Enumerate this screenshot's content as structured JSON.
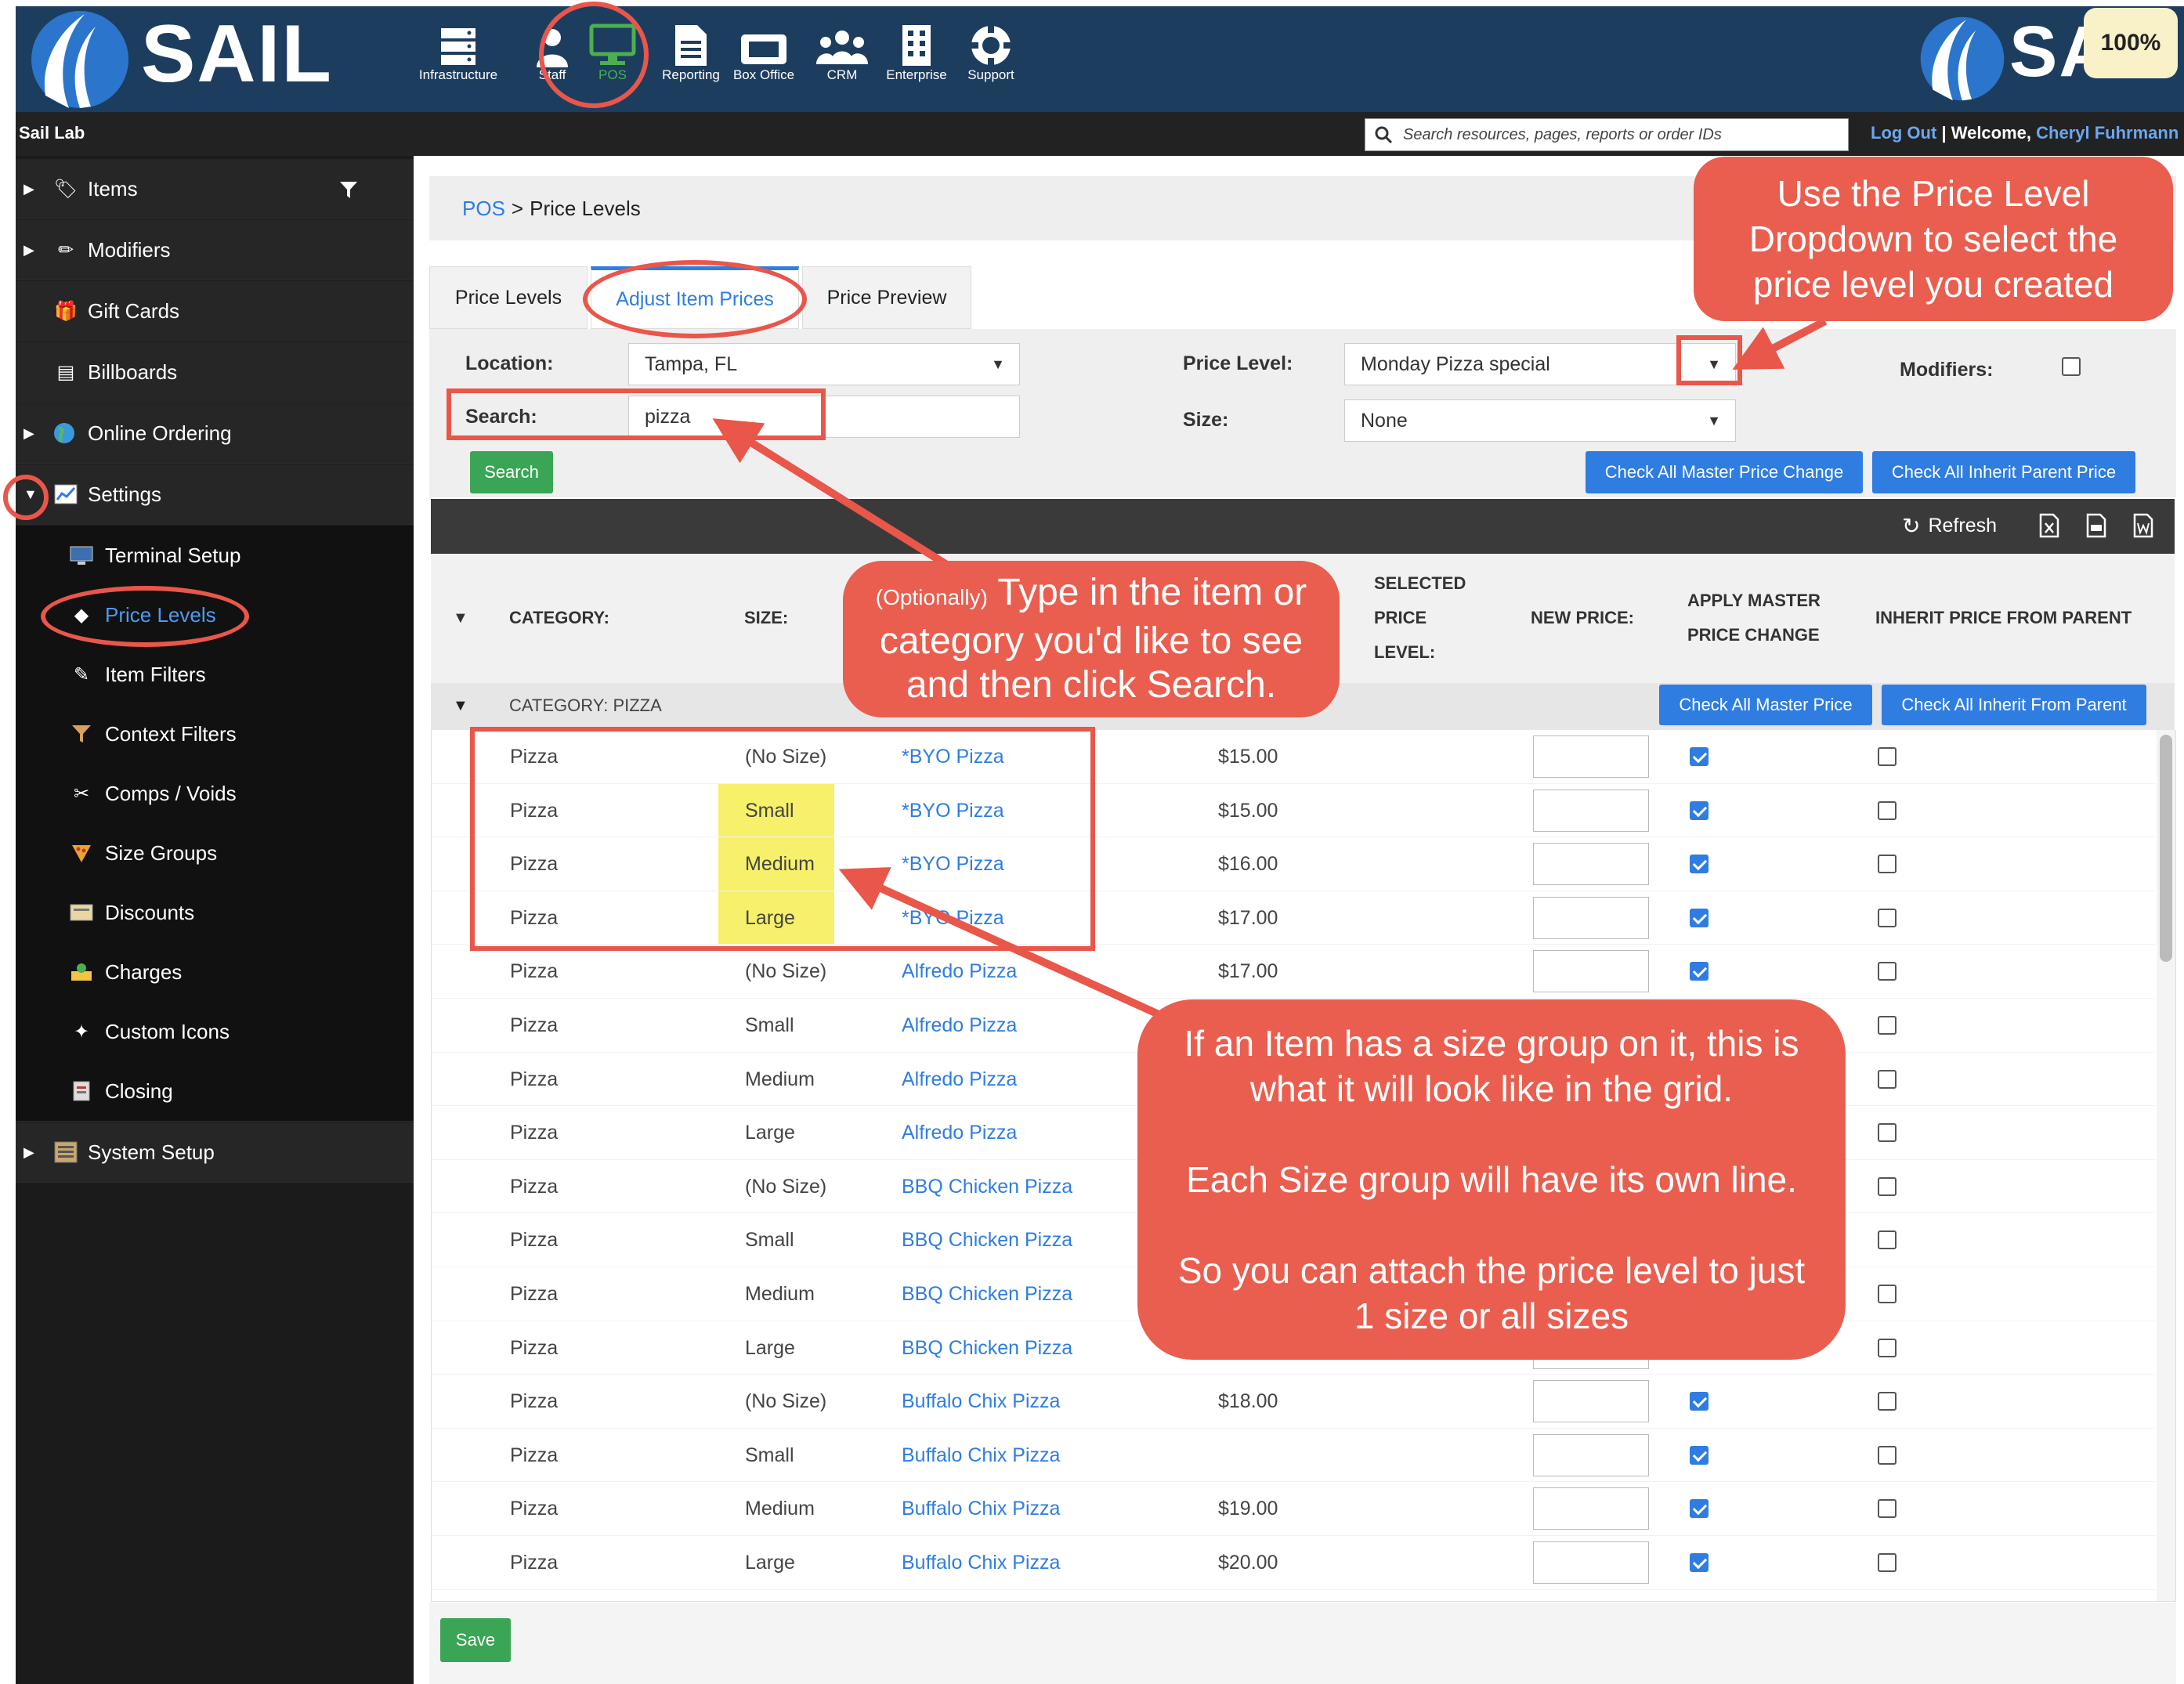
{
  "app": {
    "logo": "SAIL",
    "zoom": "100%"
  },
  "topnav": [
    {
      "label": "Infrastructure",
      "icon": "server-icon"
    },
    {
      "label": "Staff",
      "icon": "staff-icon"
    },
    {
      "label": "POS",
      "icon": "monitor-icon"
    },
    {
      "label": "Reporting",
      "icon": "report-icon"
    },
    {
      "label": "Box Office",
      "icon": "ticket-icon"
    },
    {
      "label": "CRM",
      "icon": "people-icon"
    },
    {
      "label": "Enterprise",
      "icon": "building-icon"
    },
    {
      "label": "Support",
      "icon": "lifebuoy-icon"
    }
  ],
  "header": {
    "site": "Sail Lab",
    "search_placeholder": "Search resources, pages, reports or order IDs",
    "logout": "Log Out",
    "welcome": "Welcome,",
    "user": "Cheryl Fuhrmann"
  },
  "sidebar": {
    "items": [
      {
        "label": "Items",
        "icon": "items-icon"
      },
      {
        "label": "Modifiers",
        "icon": "modifiers-icon"
      },
      {
        "label": "Gift Cards",
        "icon": "gift-card-icon"
      },
      {
        "label": "Billboards",
        "icon": "billboard-icon"
      },
      {
        "label": "Online Ordering",
        "icon": "globe-icon"
      },
      {
        "label": "Settings",
        "icon": "settings-icon"
      },
      {
        "label": "Terminal Setup",
        "icon": "terminal-icon"
      },
      {
        "label": "Price Levels",
        "icon": "price-tag-icon"
      },
      {
        "label": "Item Filters",
        "icon": "filter-icon"
      },
      {
        "label": "Context Filters",
        "icon": "funnel-icon"
      },
      {
        "label": "Comps / Voids",
        "icon": "comps-icon"
      },
      {
        "label": "Size Groups",
        "icon": "pizza-icon"
      },
      {
        "label": "Discounts",
        "icon": "discount-icon"
      },
      {
        "label": "Charges",
        "icon": "charges-icon"
      },
      {
        "label": "Custom Icons",
        "icon": "custom-icons-icon"
      },
      {
        "label": "Closing",
        "icon": "closing-icon"
      },
      {
        "label": "System Setup",
        "icon": "system-setup-icon"
      }
    ]
  },
  "breadcrumb": {
    "root": "POS",
    "sep": ">",
    "current": "Price Levels"
  },
  "tabs": [
    "Price Levels",
    "Adjust Item Prices",
    "Price Preview"
  ],
  "filters": {
    "location_label": "Location:",
    "location_value": "Tampa, FL",
    "search_label": "Search:",
    "search_value": "pizza",
    "search_button": "Search",
    "price_level_label": "Price Level:",
    "price_level_value": "Monday Pizza special",
    "size_label": "Size:",
    "size_value": "None",
    "modifiers_label": "Modifiers:",
    "check_all_master": "Check All Master Price Change",
    "check_all_inherit": "Check All Inherit Parent Price"
  },
  "toolbar": {
    "refresh": "Refresh"
  },
  "grid": {
    "headers": {
      "category": "CATEGORY:",
      "size": "SIZE:",
      "selected_1": "SELECTED",
      "selected_2": "PRICE",
      "selected_3": "LEVEL:",
      "new_price": "NEW PRICE:",
      "apply_1": "APPLY MASTER",
      "apply_2": "PRICE CHANGE",
      "inherit": "INHERIT PRICE FROM PARENT"
    },
    "category_row": {
      "label": "CATEGORY: PIZZA",
      "check_master": "Check All Master Price",
      "check_inherit": "Check All Inherit From Parent"
    },
    "rows": [
      {
        "category": "Pizza",
        "size": "(No Size)",
        "item": "*BYO Pizza",
        "price": "$15.00",
        "master": true,
        "inherit": false,
        "hl": false
      },
      {
        "category": "Pizza",
        "size": "Small",
        "item": "*BYO Pizza",
        "price": "$15.00",
        "master": true,
        "inherit": false,
        "hl": true
      },
      {
        "category": "Pizza",
        "size": "Medium",
        "item": "*BYO Pizza",
        "price": "$16.00",
        "master": true,
        "inherit": false,
        "hl": true
      },
      {
        "category": "Pizza",
        "size": "Large",
        "item": "*BYO Pizza",
        "price": "$17.00",
        "master": true,
        "inherit": false,
        "hl": true
      },
      {
        "category": "Pizza",
        "size": "(No Size)",
        "item": "Alfredo Pizza",
        "price": "$17.00",
        "master": true,
        "inherit": false,
        "hl": false
      },
      {
        "category": "Pizza",
        "size": "Small",
        "item": "Alfredo Pizza",
        "price": "",
        "master": false,
        "inherit": false,
        "hl": false
      },
      {
        "category": "Pizza",
        "size": "Medium",
        "item": "Alfredo Pizza",
        "price": "",
        "master": false,
        "inherit": false,
        "hl": false
      },
      {
        "category": "Pizza",
        "size": "Large",
        "item": "Alfredo Pizza",
        "price": "",
        "master": false,
        "inherit": false,
        "hl": false
      },
      {
        "category": "Pizza",
        "size": "(No Size)",
        "item": "BBQ Chicken Pizza",
        "price": "",
        "master": false,
        "inherit": false,
        "hl": false
      },
      {
        "category": "Pizza",
        "size": "Small",
        "item": "BBQ Chicken Pizza",
        "price": "",
        "master": false,
        "inherit": false,
        "hl": false
      },
      {
        "category": "Pizza",
        "size": "Medium",
        "item": "BBQ Chicken Pizza",
        "price": "",
        "master": false,
        "inherit": false,
        "hl": false
      },
      {
        "category": "Pizza",
        "size": "Large",
        "item": "BBQ Chicken Pizza",
        "price": "",
        "master": false,
        "inherit": false,
        "hl": false
      },
      {
        "category": "Pizza",
        "size": "(No Size)",
        "item": "Buffalo Chix Pizza",
        "price": "$18.00",
        "master": true,
        "inherit": false,
        "hl": false
      },
      {
        "category": "Pizza",
        "size": "Small",
        "item": "Buffalo Chix Pizza",
        "price": "",
        "master": true,
        "inherit": false,
        "hl": false
      },
      {
        "category": "Pizza",
        "size": "Medium",
        "item": "Buffalo Chix Pizza",
        "price": "$19.00",
        "master": true,
        "inherit": false,
        "hl": false
      },
      {
        "category": "Pizza",
        "size": "Large",
        "item": "Buffalo Chix Pizza",
        "price": "$20.00",
        "master": true,
        "inherit": false,
        "hl": false
      }
    ],
    "save": "Save"
  },
  "callouts": {
    "price_level": "Use the Price Level Dropdown to select the price level you created",
    "search_prefix": "(Optionally)",
    "search_text": "Type in the item or category you'd like to see and then click Search.",
    "size_group_1": "If an Item has a size group on it, this is what it will look like in the grid.",
    "size_group_2": "Each Size group will have its own line.",
    "size_group_3": "So you can attach the price level to just 1 size or all sizes"
  },
  "colors": {
    "nav": "#1d3d5f",
    "accent": "#2f7de1",
    "callout": "#e95e4f",
    "pos_green": "#4caf50",
    "highlight": "#f6f06a"
  }
}
